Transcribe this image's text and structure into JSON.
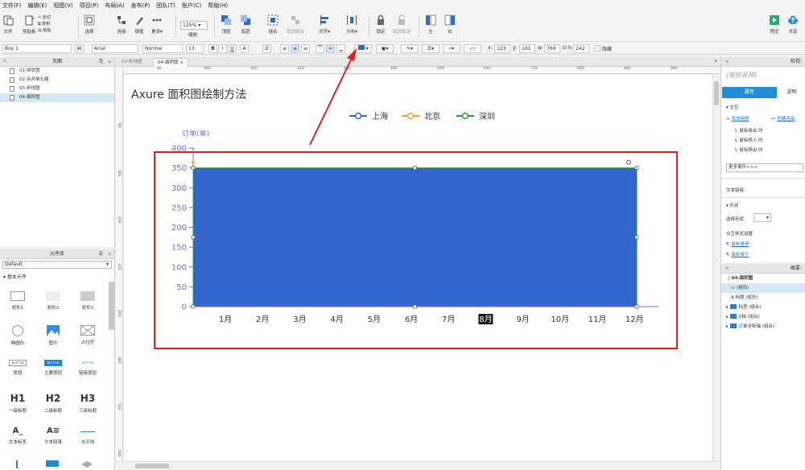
{
  "menu": [
    "文件(F)",
    "编辑(E)",
    "视图(V)",
    "项目(P)",
    "布局(A)",
    "发布(P)",
    "团队(T)",
    "账户(C)",
    "帮助(H)"
  ],
  "toolbar": {
    "file": "文件",
    "clipboard": "剪贴板",
    "cut": "剪切",
    "copy": "复制",
    "paste": "粘贴",
    "select": "选择",
    "connect": "连接",
    "draw": "钢笔",
    "more": "更多▾",
    "zoom": "125%",
    "zoom_label": "缩放",
    "top": "顶层",
    "bottom": "底层",
    "group": "组合",
    "ungroup": "取消组合",
    "align": "对齐▾",
    "distribute": "分布▾",
    "lock": "锁定",
    "unlock": "取消锁定",
    "left": "左",
    "right": "右",
    "preview": "预览",
    "share": "共享"
  },
  "formatbar": {
    "widget_name": "Box 1",
    "font": "Arial",
    "style": "Normal",
    "size": "13",
    "x_label": "x:",
    "x": "123",
    "y_label": "y:",
    "y": "161",
    "w_label": "w:",
    "w": "769",
    "h_label": "h:",
    "h": "242",
    "hidden_label": "隐藏"
  },
  "pages_panel": {
    "title": "页面",
    "items": [
      "01-饼状图",
      "02-合并单元格",
      "03-折线图",
      "04-面积图"
    ]
  },
  "library_panel": {
    "title": "元件库",
    "dropdown": "Default",
    "section": "基本元件",
    "items": [
      "矩形1",
      "矩形2",
      "矩形3",
      "椭圆形",
      "图片",
      "占位符",
      "按钮",
      "主要按钮",
      "链接按钮",
      "一级标题",
      "二级标题",
      "三级标题",
      "文本标签",
      "文本段落",
      "水平线"
    ],
    "button_text": "BUTTON",
    "headings": [
      "H1",
      "H2",
      "H3"
    ]
  },
  "tabs": [
    "03-折线图",
    "04-面积图"
  ],
  "ruler_h": [
    "80",
    "160",
    "240",
    "320",
    "400",
    "480",
    "560",
    "640",
    "720",
    "800",
    "880",
    "960"
  ],
  "ruler_v": [
    "80",
    "160",
    "240",
    "320",
    "400",
    "480",
    "560",
    "640"
  ],
  "canvas": {
    "title": "Axure 面积图绘制方法"
  },
  "chart_data": {
    "type": "area",
    "ylabel": "订单(单)",
    "ylim": [
      0,
      400
    ],
    "yticks": [
      0,
      50,
      100,
      150,
      200,
      250,
      300,
      350,
      400
    ],
    "categories": [
      "1月",
      "2月",
      "3月",
      "4月",
      "5月",
      "6月",
      "7月",
      "8月",
      "9月",
      "10月",
      "11月",
      "12月"
    ],
    "highlight_category": "8月",
    "legend": [
      {
        "name": "上海",
        "color": "#3a64c8"
      },
      {
        "name": "北京",
        "color": "#f0a030"
      },
      {
        "name": "深圳",
        "color": "#2a9a2a"
      }
    ],
    "series": [
      {
        "name": "selected-rect",
        "values": [
          350,
          350,
          350,
          350,
          350,
          350,
          350,
          350,
          350,
          350,
          350,
          350
        ]
      }
    ],
    "fill_color": "#3366cc",
    "axis_color": "#7a6ad0",
    "legend_position": "top-center"
  },
  "inspector": {
    "title": "检视:",
    "name_placeholder": "(矩形名称)",
    "tab_props": "属性",
    "tab_notes": "说明",
    "interaction_title": "交互",
    "add_case": "添加用例",
    "create_link": "创建连接",
    "events": [
      "鼠标单击 时",
      "鼠标移入 时",
      "鼠标移出 时"
    ],
    "more_events": "更多事件>>>",
    "text_link": "文本链接",
    "shape_title": "形状",
    "select_shape": "选择形状",
    "interaction_style": "交互样式设置",
    "hover": "鼠标悬停",
    "mousedown": "鼠标按下"
  },
  "outline": {
    "title": "概要:",
    "page": "04-面积图",
    "items": [
      "(矩形)",
      "标题 (矩形)",
      "标签 (组合)",
      "X轴 (组合)",
      "订单坐标轴 (组合)"
    ]
  }
}
